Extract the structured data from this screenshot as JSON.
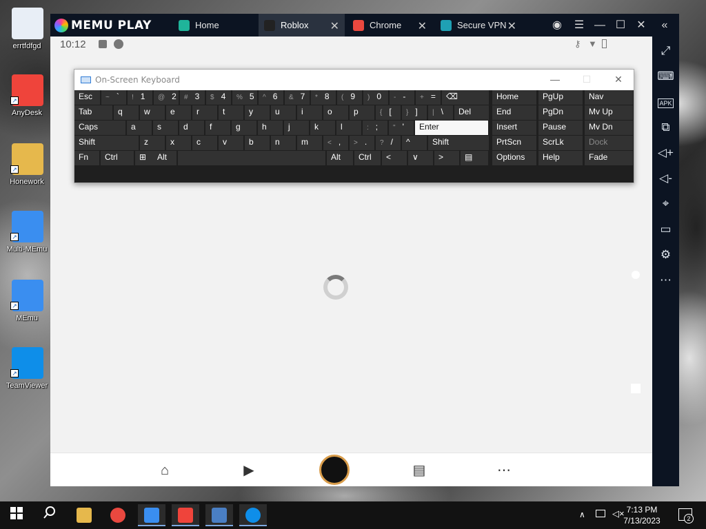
{
  "desktop": {
    "icons": [
      {
        "label": "errtfdfgd",
        "icon": "recycle-bin-icon",
        "color": "#e8eef6"
      },
      {
        "label": "AnyDesk",
        "icon": "anydesk-icon",
        "color": "#ef443b"
      },
      {
        "label": "Honework",
        "icon": "folder-icon",
        "color": "#e6b84c"
      },
      {
        "label": "Multi-MEmu",
        "icon": "multi-memu-icon",
        "color": "#3a8ef0"
      },
      {
        "label": "MEmu",
        "icon": "memu-icon",
        "color": "#3a8ef0"
      },
      {
        "label": "TeamViewer",
        "icon": "teamviewer-icon",
        "color": "#0e8ee9"
      }
    ]
  },
  "emulator": {
    "brand": "MEMU PLAY",
    "tabs": [
      {
        "label": "Home",
        "icon": "home-app-icon",
        "color": "#1fb49a",
        "closable": false
      },
      {
        "label": "Roblox",
        "icon": "roblox-icon",
        "color": "#222222",
        "closable": true
      },
      {
        "label": "Chrome",
        "icon": "chrome-icon",
        "color": "#e9483f",
        "closable": true
      },
      {
        "label": "Secure VPN",
        "icon": "vpn-icon",
        "color": "#1fa0b4",
        "closable": true
      }
    ],
    "close_glyph": "✕",
    "status_time": "10:12",
    "sidebar_icons": [
      "fullscreen-icon",
      "keyboard-icon",
      "apk-icon",
      "multi-window-icon",
      "volume-up-icon",
      "volume-down-icon",
      "location-icon",
      "folder-icon",
      "settings-icon",
      "more-icon"
    ],
    "apk_label": "APK",
    "nav_icons": [
      "home-icon",
      "play-icon",
      "avatar-icon",
      "chat-icon",
      "more-icon"
    ]
  },
  "keyboard": {
    "title": "On-Screen Keyboard",
    "rows": [
      [
        {
          "label": "Esc"
        },
        {
          "alt": "~",
          "label": "`"
        },
        {
          "alt": "!",
          "label": "1"
        },
        {
          "alt": "@",
          "label": "2"
        },
        {
          "alt": "#",
          "label": "3"
        },
        {
          "alt": "$",
          "label": "4"
        },
        {
          "alt": "%",
          "label": "5"
        },
        {
          "alt": "^",
          "label": "6"
        },
        {
          "alt": "&",
          "label": "7"
        },
        {
          "alt": "*",
          "label": "8"
        },
        {
          "alt": "(",
          "label": "9"
        },
        {
          "alt": ")",
          "label": "0"
        },
        {
          "alt": "-",
          "label": "-"
        },
        {
          "alt": "+",
          "label": "="
        },
        {
          "label": "⌫"
        },
        {
          "label": "Home"
        },
        {
          "label": "PgUp"
        },
        {
          "label": "Nav"
        }
      ],
      [
        {
          "label": "Tab"
        },
        {
          "label": "q"
        },
        {
          "label": "w"
        },
        {
          "label": "e"
        },
        {
          "label": "r"
        },
        {
          "label": "t"
        },
        {
          "label": "y"
        },
        {
          "label": "u"
        },
        {
          "label": "i"
        },
        {
          "label": "o"
        },
        {
          "label": "p"
        },
        {
          "alt": "{",
          "label": "["
        },
        {
          "alt": "}",
          "label": "]"
        },
        {
          "alt": "|",
          "label": "\\"
        },
        {
          "label": "Del"
        },
        {
          "label": "End"
        },
        {
          "label": "PgDn"
        },
        {
          "label": "Mv Up"
        }
      ],
      [
        {
          "label": "Caps"
        },
        {
          "label": "a"
        },
        {
          "label": "s"
        },
        {
          "label": "d"
        },
        {
          "label": "f"
        },
        {
          "label": "g"
        },
        {
          "label": "h"
        },
        {
          "label": "j"
        },
        {
          "label": "k"
        },
        {
          "label": "l"
        },
        {
          "alt": ":",
          "label": ";"
        },
        {
          "alt": "\"",
          "label": "'"
        },
        {
          "label": "Enter"
        },
        {
          "label": "Insert"
        },
        {
          "label": "Pause"
        },
        {
          "label": "Mv Dn"
        }
      ],
      [
        {
          "label": "Shift"
        },
        {
          "label": "z"
        },
        {
          "label": "x"
        },
        {
          "label": "c"
        },
        {
          "label": "v"
        },
        {
          "label": "b"
        },
        {
          "label": "n"
        },
        {
          "label": "m"
        },
        {
          "alt": "<",
          "label": ","
        },
        {
          "alt": ">",
          "label": "."
        },
        {
          "alt": "?",
          "label": "/"
        },
        {
          "label": "^"
        },
        {
          "label": "Shift"
        },
        {
          "label": "PrtScn"
        },
        {
          "label": "ScrLk"
        },
        {
          "label": "Dock"
        }
      ],
      [
        {
          "label": "Fn"
        },
        {
          "label": "Ctrl"
        },
        {
          "label": "⊞"
        },
        {
          "label": "Alt"
        },
        {
          "label": ""
        },
        {
          "label": "Alt"
        },
        {
          "label": "Ctrl"
        },
        {
          "label": "<"
        },
        {
          "label": "∨"
        },
        {
          "label": ">"
        },
        {
          "label": "▤"
        },
        {
          "label": "Options"
        },
        {
          "label": "Help"
        },
        {
          "label": "Fade"
        }
      ]
    ],
    "hovered_key": "Enter",
    "disabled_key": "Dock"
  },
  "taskbar": {
    "apps": [
      "file-explorer-icon",
      "chrome-icon",
      "memu-icon",
      "anydesk-icon",
      "on-screen-keyboard-icon",
      "teamviewer-icon"
    ],
    "clock_time": "7:13 PM",
    "clock_date": "7/13/2023",
    "notification_count": "2"
  }
}
